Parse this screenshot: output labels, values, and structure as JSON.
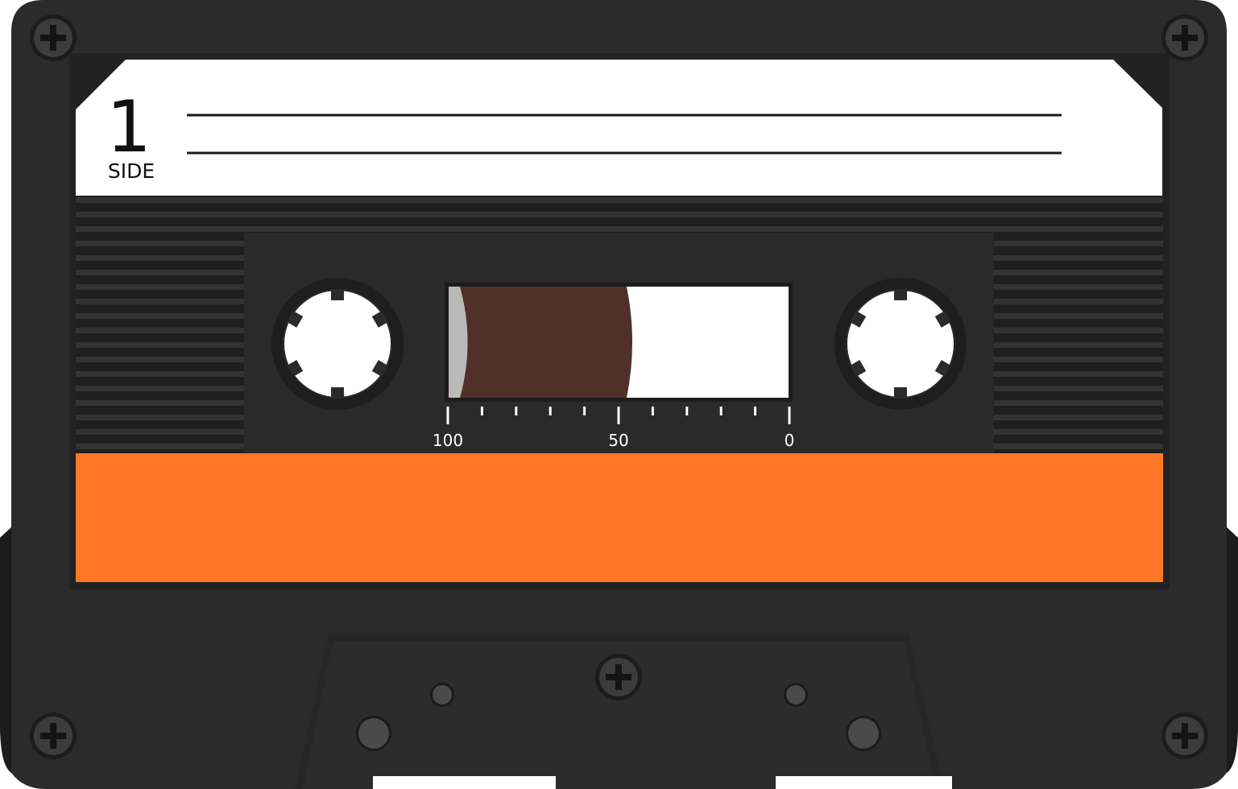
{
  "label": {
    "side_number": "1",
    "side_text": "SIDE"
  },
  "tape_counter": {
    "scale_labels": [
      "100",
      "50",
      "0"
    ],
    "tape_remaining_fraction": 0.5
  },
  "icons": {
    "screws": "phillips-screw-icon",
    "reels": "reel-hub-icon"
  },
  "colors": {
    "shell": "#2b2b2b",
    "label": "#ffffff",
    "stripe": "#ff7826",
    "tape": "#52302a",
    "window_leader": "#b9b9b9"
  }
}
